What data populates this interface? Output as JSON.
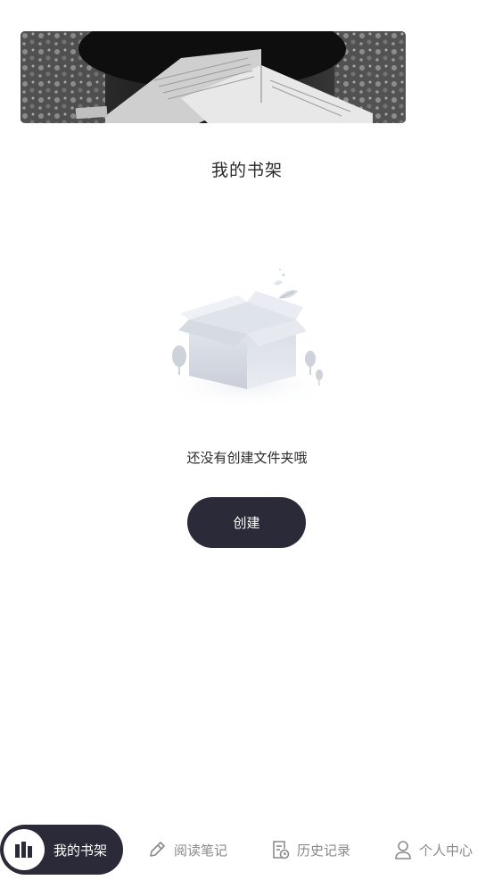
{
  "banner": {
    "image": "photo-of-person-reading-open-book"
  },
  "page": {
    "title": "我的书架"
  },
  "empty_state": {
    "illustration": "empty-box-illustration",
    "message": "还没有创建文件夹哦"
  },
  "actions": {
    "create_label": "创建"
  },
  "nav": {
    "items": [
      {
        "label": "我的书架",
        "icon": "bookshelf-icon",
        "active": true
      },
      {
        "label": "阅读笔记",
        "icon": "pencil-icon",
        "active": false
      },
      {
        "label": "历史记录",
        "icon": "history-record-icon",
        "active": false
      },
      {
        "label": "个人中心",
        "icon": "user-icon",
        "active": false
      }
    ]
  },
  "colors": {
    "primary_dark": "#2b2a38",
    "inactive_text": "#8a8a8a",
    "background": "#ffffff"
  }
}
